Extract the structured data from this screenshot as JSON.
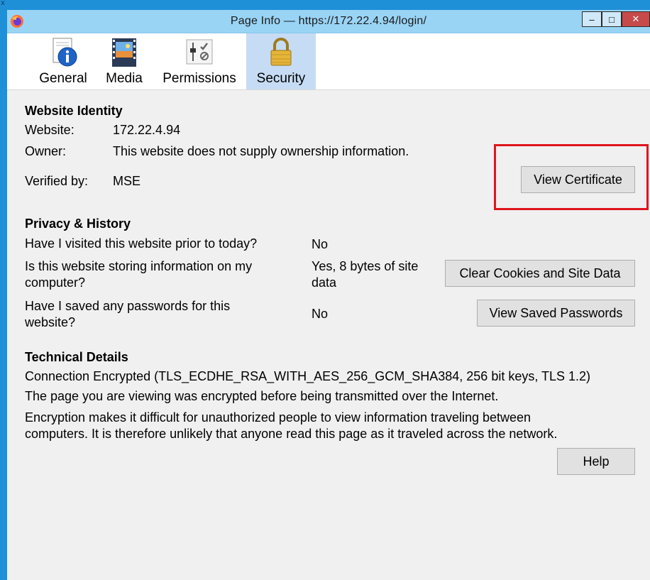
{
  "desktop": {
    "corner_glyph": "x"
  },
  "window": {
    "title": "Page Info — https://172.22.4.94/login/",
    "controls": {
      "minimize": "–",
      "maximize": "□",
      "close": "✕"
    }
  },
  "tabs": [
    {
      "label": "General",
      "icon": "info-icon"
    },
    {
      "label": "Media",
      "icon": "media-icon"
    },
    {
      "label": "Permissions",
      "icon": "permissions-icon"
    },
    {
      "label": "Security",
      "icon": "lock-icon",
      "selected": true
    }
  ],
  "identity": {
    "heading": "Website Identity",
    "website_label": "Website:",
    "website_value": "172.22.4.94",
    "owner_label": "Owner:",
    "owner_value": "This website does not supply ownership information.",
    "verified_label": "Verified by:",
    "verified_value": "MSE",
    "view_certificate": "View Certificate"
  },
  "privacy": {
    "heading": "Privacy & History",
    "q1": "Have I visited this website prior to today?",
    "a1": "No",
    "q2_line1": "Is this website storing information on my",
    "q2_line2": "computer?",
    "a2_line1": "Yes, 8 bytes of site",
    "a2_line2": "data",
    "clear_cookies": "Clear Cookies and Site Data",
    "q3_line1": "Have I saved any passwords for this",
    "q3_line2": "website?",
    "a3": "No",
    "view_passwords": "View Saved Passwords"
  },
  "technical": {
    "heading": "Technical Details",
    "connection": "Connection Encrypted (TLS_ECDHE_RSA_WITH_AES_256_GCM_SHA384, 256 bit keys, TLS 1.2)",
    "line2": "The page you are viewing was encrypted before being transmitted over the Internet.",
    "line3a": "Encryption makes it difficult for unauthorized people to view information traveling between",
    "line3b": "computers. It is therefore unlikely that anyone read this page as it traveled across the network."
  },
  "help": "Help",
  "colors": {
    "titlebar": "#99d4f5",
    "selected_tab": "#c6dcf4",
    "highlight": "#e0151d",
    "desktop_edge": "#1e90d8"
  }
}
